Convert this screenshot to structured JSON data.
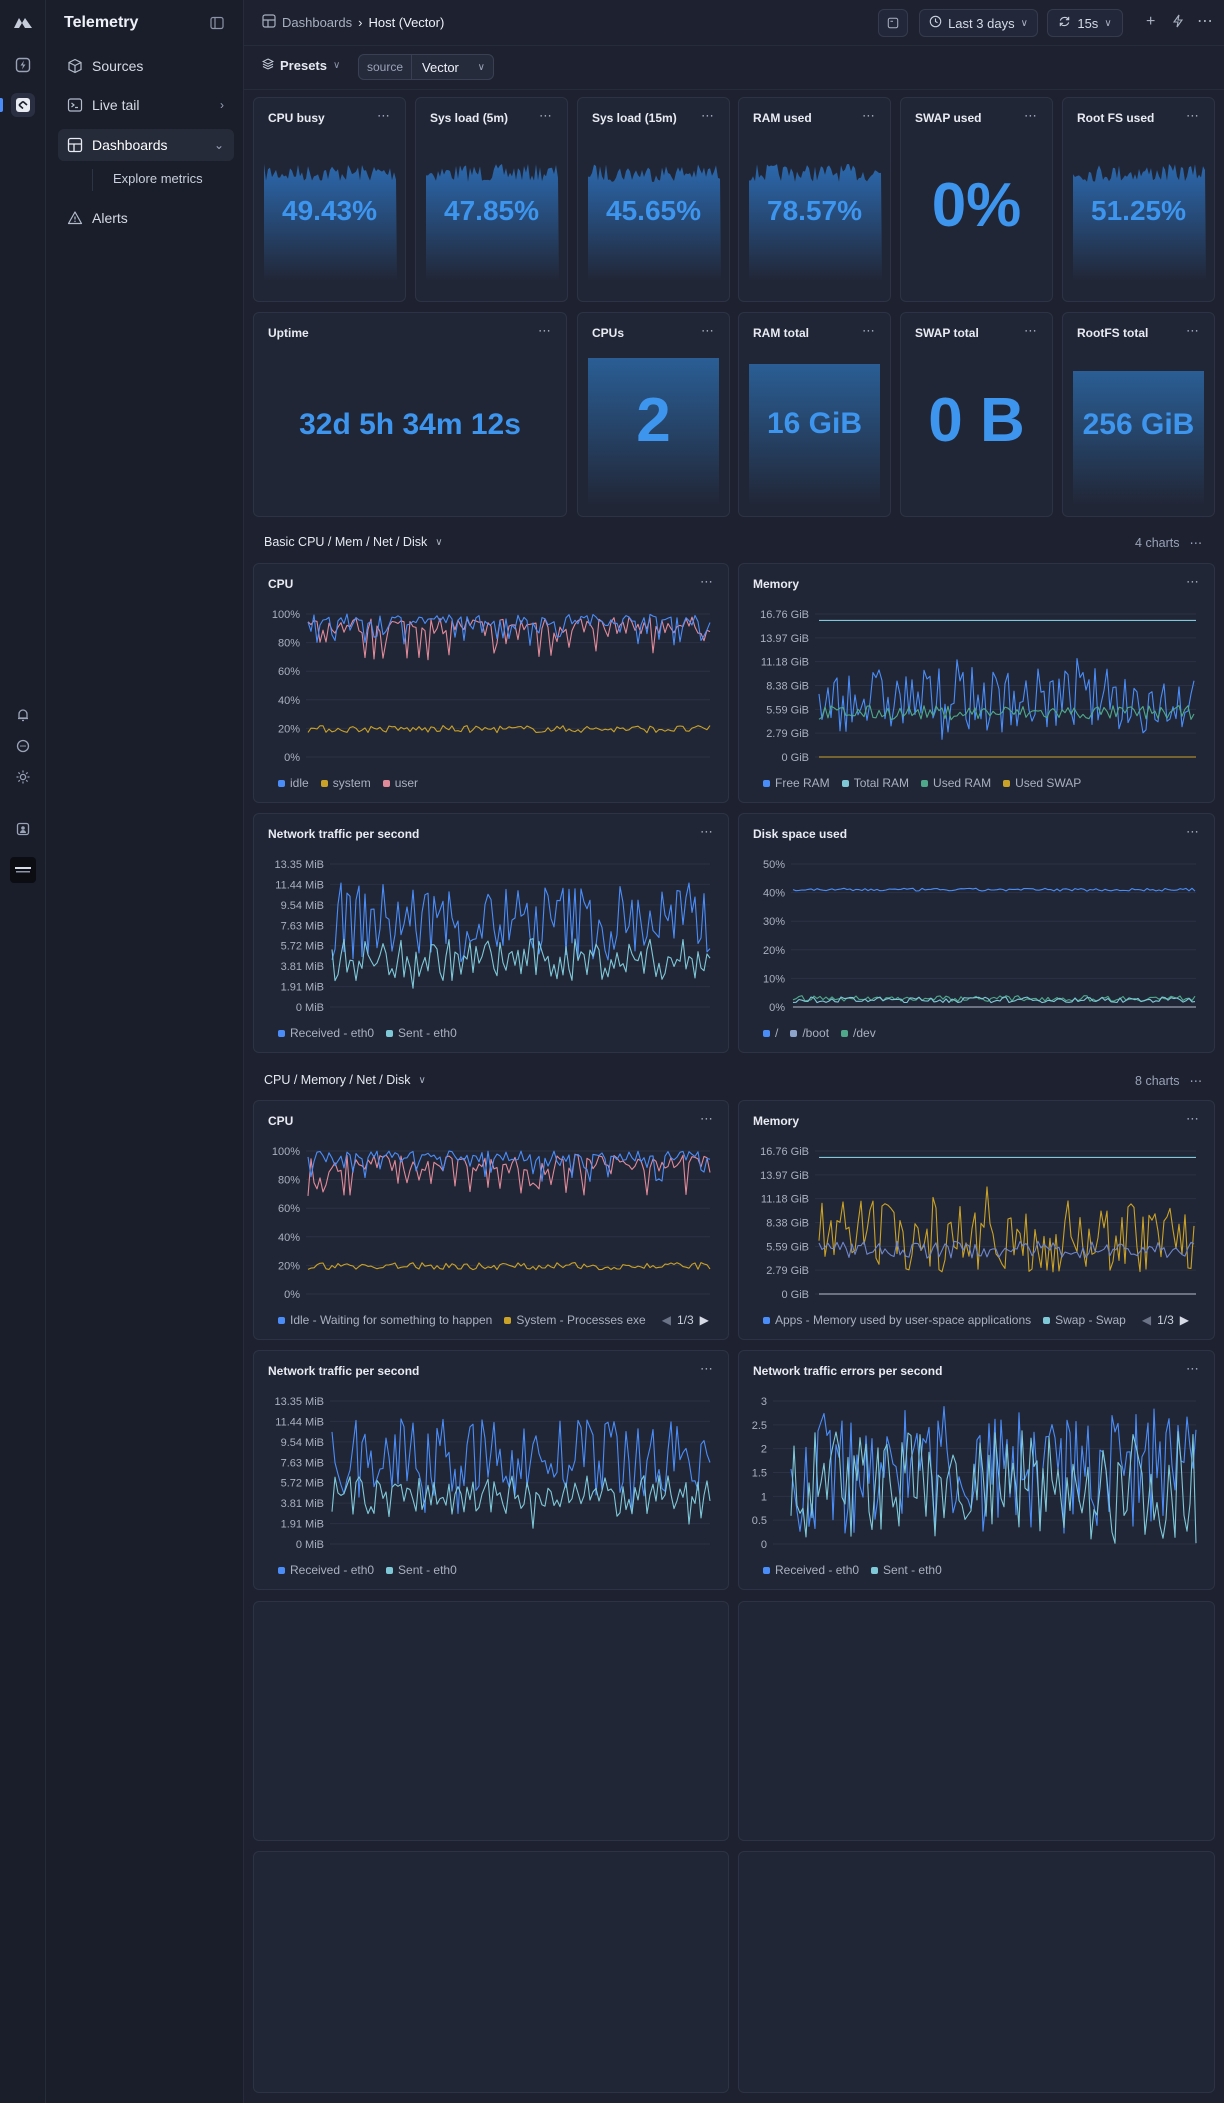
{
  "app": {
    "title": "Telemetry"
  },
  "sidebar": {
    "items": [
      {
        "label": "Sources",
        "icon": "cube-icon"
      },
      {
        "label": "Live tail",
        "icon": "terminal-icon"
      },
      {
        "label": "Dashboards",
        "icon": "grid-icon"
      },
      {
        "label": "Alerts",
        "icon": "warning-icon"
      }
    ],
    "sub_item": "Explore metrics"
  },
  "breadcrumb": {
    "root": "Dashboards",
    "current": "Host (Vector)"
  },
  "toolbar": {
    "time_range": "Last 3 days",
    "refresh": "15s"
  },
  "filters": {
    "presets_label": "Presets",
    "chip_key": "source",
    "chip_value": "Vector"
  },
  "stats_row1": [
    {
      "title": "CPU busy",
      "value": "49.43%"
    },
    {
      "title": "Sys load (5m)",
      "value": "47.85%"
    },
    {
      "title": "Sys load (15m)",
      "value": "45.65%"
    },
    {
      "title": "RAM used",
      "value": "78.57%"
    },
    {
      "title": "SWAP used",
      "value": "0%"
    },
    {
      "title": "Root FS used",
      "value": "51.25%"
    }
  ],
  "stats_row2": [
    {
      "title": "Uptime",
      "value": "32d 5h 34m 12s"
    },
    {
      "title": "CPUs",
      "value": "2"
    },
    {
      "title": "RAM total",
      "value": "16 GiB"
    },
    {
      "title": "SWAP total",
      "value": "0 B"
    },
    {
      "title": "RootFS total",
      "value": "256 GiB"
    }
  ],
  "sections": [
    {
      "title": "Basic CPU / Mem / Net / Disk",
      "count": "4 charts"
    },
    {
      "title": "CPU / Memory / Net / Disk",
      "count": "8 charts"
    }
  ],
  "colors": {
    "accent": "#3d95ee",
    "blue": "#4a8df8",
    "teal": "#7ec8d8",
    "green": "#4fa88a",
    "yellow": "#c9a227",
    "pink": "#e08a99"
  },
  "chart_data": [
    {
      "type": "line",
      "title": "CPU",
      "ylabels": [
        "100%",
        "80%",
        "60%",
        "40%",
        "20%",
        "0%"
      ],
      "ylim": [
        0,
        100
      ],
      "series": [
        {
          "name": "idle",
          "level": [
            70,
            100
          ]
        },
        {
          "name": "system",
          "level": [
            16,
            24
          ]
        },
        {
          "name": "user",
          "level": [
            70,
            100
          ]
        }
      ]
    },
    {
      "type": "line",
      "title": "Memory",
      "ylabels": [
        "16.76 GiB",
        "13.97 GiB",
        "11.18 GiB",
        "8.38 GiB",
        "5.59 GiB",
        "2.79 GiB",
        "0 GiB"
      ],
      "ylim": [
        0,
        16.76
      ],
      "series": [
        {
          "name": "Free RAM"
        },
        {
          "name": "Total RAM",
          "value": 16
        },
        {
          "name": "Used RAM"
        },
        {
          "name": "Used SWAP",
          "value": 0
        }
      ]
    },
    {
      "type": "line",
      "title": "Network traffic per second",
      "ylabels": [
        "13.35 MiB",
        "11.44 MiB",
        "9.54 MiB",
        "7.63 MiB",
        "5.72 MiB",
        "3.81 MiB",
        "1.91 MiB",
        "0 MiB"
      ],
      "ylim": [
        0,
        13.35
      ],
      "series": [
        {
          "name": "Received - eth0"
        },
        {
          "name": "Sent - eth0"
        }
      ]
    },
    {
      "type": "line",
      "title": "Disk space used",
      "ylabels": [
        "50%",
        "40%",
        "30%",
        "20%",
        "10%",
        "0%"
      ],
      "ylim": [
        0,
        50
      ],
      "series": [
        {
          "name": "/",
          "value": 41
        },
        {
          "name": "/boot",
          "value": 3
        },
        {
          "name": "/dev",
          "value": 2
        }
      ]
    },
    {
      "type": "line",
      "title": "CPU",
      "ylabels": [
        "100%",
        "80%",
        "60%",
        "40%",
        "20%",
        "0%"
      ],
      "ylim": [
        0,
        100
      ],
      "series": [
        {
          "name": "Idle - Waiting for something to happen"
        },
        {
          "name": "System - Processes exe"
        }
      ],
      "pager": "1/3"
    },
    {
      "type": "line",
      "title": "Memory",
      "ylabels": [
        "16.76 GiB",
        "13.97 GiB",
        "11.18 GiB",
        "8.38 GiB",
        "5.59 GiB",
        "2.79 GiB",
        "0 GiB"
      ],
      "ylim": [
        0,
        16.76
      ],
      "series": [
        {
          "name": "Apps - Memory used by user-space applications"
        },
        {
          "name": "Swap - Swap"
        }
      ],
      "pager": "1/3"
    },
    {
      "type": "line",
      "title": "Network traffic per second",
      "ylabels": [
        "13.35 MiB",
        "11.44 MiB",
        "9.54 MiB",
        "7.63 MiB",
        "5.72 MiB",
        "3.81 MiB",
        "1.91 MiB",
        "0 MiB"
      ],
      "ylim": [
        0,
        13.35
      ],
      "series": [
        {
          "name": "Received - eth0"
        },
        {
          "name": "Sent - eth0"
        }
      ]
    },
    {
      "type": "line",
      "title": "Network traffic errors per second",
      "ylabels": [
        "3",
        "2.5",
        "2",
        "1.5",
        "1",
        "0.5",
        "0"
      ],
      "ylim": [
        0,
        3
      ],
      "series": [
        {
          "name": "Received - eth0"
        },
        {
          "name": "Sent - eth0"
        }
      ]
    }
  ]
}
